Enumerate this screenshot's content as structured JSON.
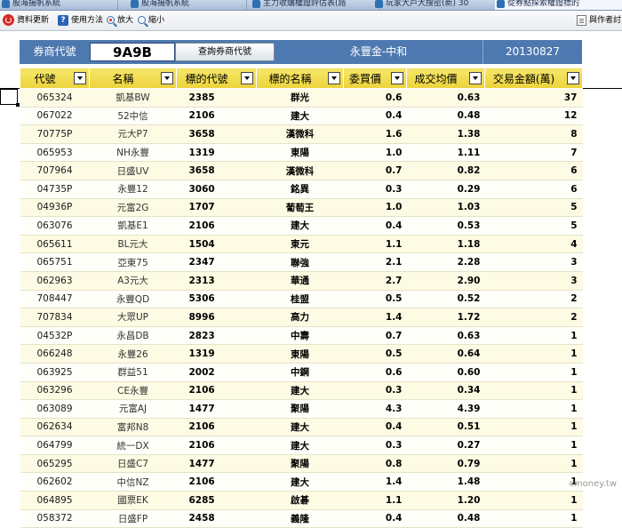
{
  "tabs": [
    {
      "label": "股海揚帆系統"
    },
    {
      "label": "股海揚帆系統"
    },
    {
      "label": "主力收購權證評估表(諮"
    },
    {
      "label": "玩家大戶大搜密(新) 30"
    },
    {
      "label": "從券點探索權證標的"
    }
  ],
  "toolbar": {
    "refresh_label": "資料更新",
    "help_label": "使用方法",
    "zoom_in_label": "放大",
    "zoom_out_label": "縮小",
    "print_label": "與作者討"
  },
  "header": {
    "broker_code_label": "券商代號",
    "broker_code_value": "9A9B",
    "query_button_label": "查詢券商代號",
    "broker_name": "永豐金-中和",
    "date": "20130827"
  },
  "table": {
    "columns": [
      "代號",
      "名稱",
      "標的代號",
      "標的名稱",
      "委買價",
      "成交均價",
      "交易金額(萬)"
    ],
    "rows": [
      [
        "065324",
        "凱基BW",
        "2385",
        "群光",
        "0.6",
        "0.63",
        "37"
      ],
      [
        "067022",
        "52中信",
        "2106",
        "建大",
        "0.4",
        "0.48",
        "12"
      ],
      [
        "70775P",
        "元大P7",
        "3658",
        "漢微科",
        "1.6",
        "1.38",
        "8"
      ],
      [
        "065953",
        "NH永豐",
        "1319",
        "東陽",
        "1.0",
        "1.11",
        "7"
      ],
      [
        "707964",
        "日盛UV",
        "3658",
        "漢微科",
        "0.7",
        "0.82",
        "6"
      ],
      [
        "04735P",
        "永豐12",
        "3060",
        "銘異",
        "0.3",
        "0.29",
        "6"
      ],
      [
        "04936P",
        "元富2G",
        "1707",
        "葡萄王",
        "1.0",
        "1.03",
        "5"
      ],
      [
        "063076",
        "凱基E1",
        "2106",
        "建大",
        "0.4",
        "0.53",
        "5"
      ],
      [
        "065611",
        "BL元大",
        "1504",
        "東元",
        "1.1",
        "1.18",
        "4"
      ],
      [
        "065751",
        "亞東75",
        "2347",
        "聯強",
        "2.1",
        "2.28",
        "3"
      ],
      [
        "062963",
        "A3元大",
        "2313",
        "華通",
        "2.7",
        "2.90",
        "3"
      ],
      [
        "708447",
        "永豐QD",
        "5306",
        "桂盟",
        "0.5",
        "0.52",
        "2"
      ],
      [
        "707834",
        "大眾UP",
        "8996",
        "高力",
        "1.4",
        "1.72",
        "2"
      ],
      [
        "04532P",
        "永昌DB",
        "2823",
        "中壽",
        "0.7",
        "0.63",
        "1"
      ],
      [
        "066248",
        "永豐26",
        "1319",
        "東陽",
        "0.5",
        "0.64",
        "1"
      ],
      [
        "063925",
        "群益51",
        "2002",
        "中鋼",
        "0.6",
        "0.60",
        "1"
      ],
      [
        "063296",
        "CE永豐",
        "2106",
        "建大",
        "0.3",
        "0.34",
        "1"
      ],
      [
        "063089",
        "元富AJ",
        "1477",
        "聚陽",
        "4.3",
        "4.39",
        "1"
      ],
      [
        "062634",
        "富邦N8",
        "2106",
        "建大",
        "0.4",
        "0.51",
        "1"
      ],
      [
        "064799",
        "統一DX",
        "2106",
        "建大",
        "0.3",
        "0.27",
        "1"
      ],
      [
        "065295",
        "日盛C7",
        "1477",
        "聚陽",
        "0.8",
        "0.79",
        "1"
      ],
      [
        "062602",
        "中信NZ",
        "2106",
        "建大",
        "1.4",
        "1.48",
        "1"
      ],
      [
        "064895",
        "國票EK",
        "6285",
        "啟碁",
        "1.1",
        "1.20",
        "1"
      ],
      [
        "058372",
        "日盛FP",
        "2458",
        "義隆",
        "0.4",
        "0.48",
        "1"
      ]
    ]
  },
  "watermark": "cmoney.tw",
  "colors": {
    "header_bar": "#4e79b0",
    "column_header": "#efd845",
    "row_alt": "#fdfbe3"
  }
}
